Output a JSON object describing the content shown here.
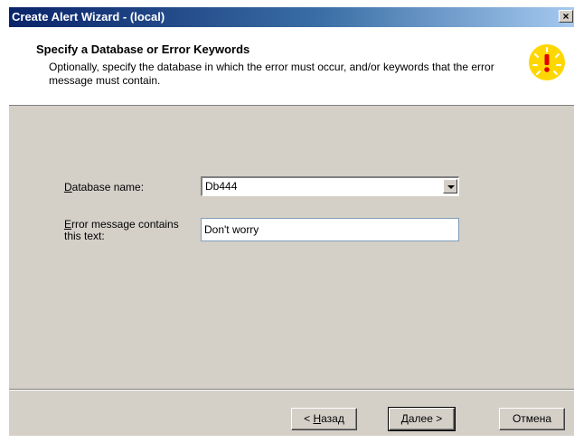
{
  "window": {
    "title": "Create Alert Wizard - (local)",
    "close_glyph": "×"
  },
  "header": {
    "title": "Specify a Database or Error Keywords",
    "description": "Optionally, specify the database in which the error must occur, and/or keywords that the error message must contain.",
    "icon": "warning-light-icon"
  },
  "form": {
    "database_label_mnemonic": "D",
    "database_label_rest": "atabase name:",
    "database_value": "Db444",
    "error_label_mnemonic": "E",
    "error_label_line1_rest": "rror message contains",
    "error_label_line2": "this text:",
    "error_value": "Don't worry"
  },
  "buttons": {
    "back_prefix": "< ",
    "back_mnemonic": "Н",
    "back_rest": "азад",
    "next_mnemonic": "Д",
    "next_rest": "алее >",
    "cancel": "Отмена"
  },
  "colors": {
    "face": "#d4d0c8",
    "title_gradient_start": "#0a246a",
    "title_gradient_end": "#a6caf0",
    "warning_yellow": "#ffd700",
    "warning_red": "#e00000"
  }
}
